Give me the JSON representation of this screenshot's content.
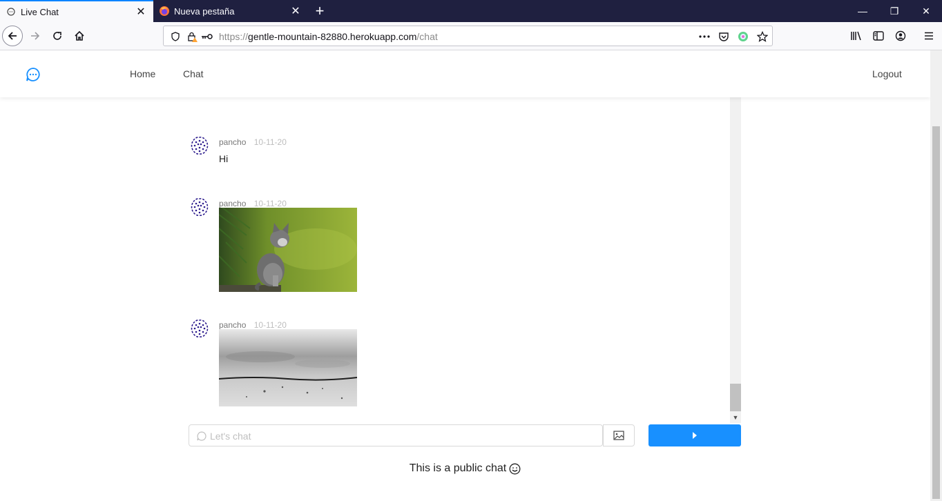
{
  "browser": {
    "tabs": [
      {
        "title": "Live Chat",
        "active": true,
        "icon": "chat-bubble-icon"
      },
      {
        "title": "Nueva pestaña",
        "active": false,
        "icon": "firefox-icon"
      }
    ],
    "url": {
      "scheme": "https://",
      "host": "gentle-mountain-82880.herokuapp.com",
      "path": "/chat"
    }
  },
  "header": {
    "logo_icon": "chat-bubble-icon",
    "menu": [
      "Home",
      "Chat"
    ],
    "logout_label": "Logout"
  },
  "messages": [
    {
      "author": "pancho",
      "date": "10-11-20",
      "type": "text",
      "text": "Hi"
    },
    {
      "author": "pancho",
      "date": "10-11-20",
      "type": "image",
      "image": "kitten-photo"
    },
    {
      "author": "pancho",
      "date": "10-11-20",
      "type": "image",
      "image": "water-surface-photo"
    }
  ],
  "composer": {
    "placeholder": "Let's chat",
    "image_button_icon": "image-icon",
    "send_button_icon": "play-arrow-icon"
  },
  "footer": {
    "text": "This is a public chat",
    "emoji": "smile-icon"
  },
  "colors": {
    "accent": "#1890ff",
    "avatar": "#2b1a8c"
  }
}
